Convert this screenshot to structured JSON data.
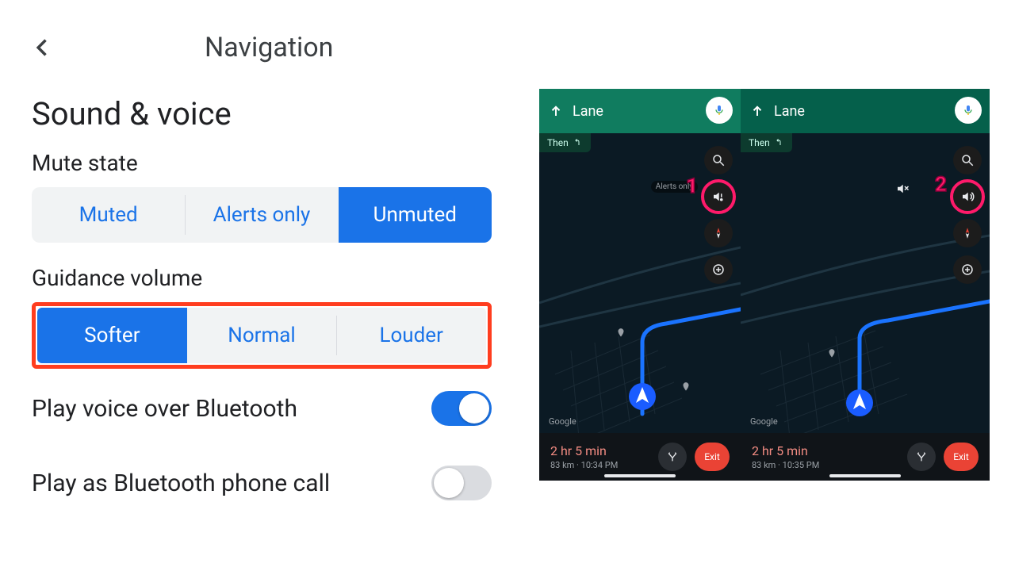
{
  "appbar": {
    "title": "Navigation"
  },
  "section": {
    "title": "Sound & voice"
  },
  "mute": {
    "label": "Mute state",
    "options": [
      "Muted",
      "Alerts only",
      "Unmuted"
    ],
    "selected": 2
  },
  "guidance": {
    "label": "Guidance volume",
    "options": [
      "Softer",
      "Normal",
      "Louder"
    ],
    "selected": 0
  },
  "toggles": {
    "bluetooth": {
      "label": "Play voice over Bluetooth",
      "on": true
    },
    "bt_phone_call": {
      "label": "Play as Bluetooth phone call",
      "on": false
    }
  },
  "phone_common": {
    "lane": "Lane",
    "then": "Then",
    "alerts_hint": "Alerts only",
    "watermark": "Google",
    "eta": "2 hr 5 min",
    "exit": "Exit"
  },
  "phones": [
    {
      "callout": "1",
      "eta_sub": "83 km · 10:34 PM"
    },
    {
      "callout": "2",
      "eta_sub": "83 km · 10:35 PM"
    }
  ]
}
